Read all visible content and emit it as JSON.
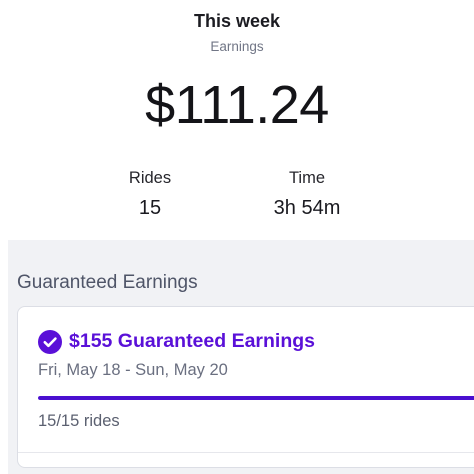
{
  "header": {
    "title": "This week",
    "subtitle": "Earnings",
    "amount": "$111.24"
  },
  "stats": {
    "rides_label": "Rides",
    "rides_value": "15",
    "time_label": "Time",
    "time_value": "3h 54m"
  },
  "guaranteed": {
    "section_title": "Guaranteed Earnings",
    "card_title": "$155 Guaranteed Earnings",
    "date_range": "Fri, May 18 - Sun, May 20",
    "progress_text": "15/15 rides",
    "progress_fraction": 1.0,
    "status_icon": "check-circle-icon"
  },
  "colors": {
    "accent": "#5a10d8",
    "progress": "#4a0fd0",
    "background_secondary": "#f1f2f5"
  }
}
